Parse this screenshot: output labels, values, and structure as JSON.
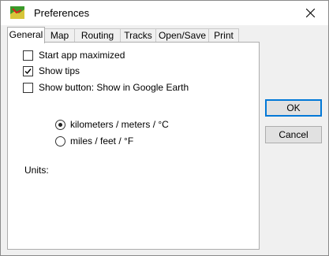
{
  "window": {
    "title": "Preferences",
    "icon": "app-map-icon"
  },
  "tabs": [
    {
      "label": "General",
      "active": true
    },
    {
      "label": "Map",
      "active": false
    },
    {
      "label": "Routing",
      "active": false
    },
    {
      "label": "Tracks",
      "active": false
    },
    {
      "label": "Open/Save",
      "active": false
    },
    {
      "label": "Print",
      "active": false
    }
  ],
  "general": {
    "options": [
      {
        "label": "Start app maximized",
        "checked": false
      },
      {
        "label": "Show tips",
        "checked": true
      },
      {
        "label": "Show button: Show in Google Earth",
        "checked": false
      }
    ],
    "units": {
      "label": "Units:",
      "choices": [
        {
          "label": "kilometers / meters / °C",
          "selected": true
        },
        {
          "label": "miles / feet / °F",
          "selected": false
        }
      ]
    }
  },
  "buttons": {
    "ok": "OK",
    "cancel": "Cancel"
  },
  "colors": {
    "focus_border": "#0078d7",
    "button_face": "#e1e1e1",
    "panel": "#ffffff",
    "dialog": "#f0f0f0"
  }
}
